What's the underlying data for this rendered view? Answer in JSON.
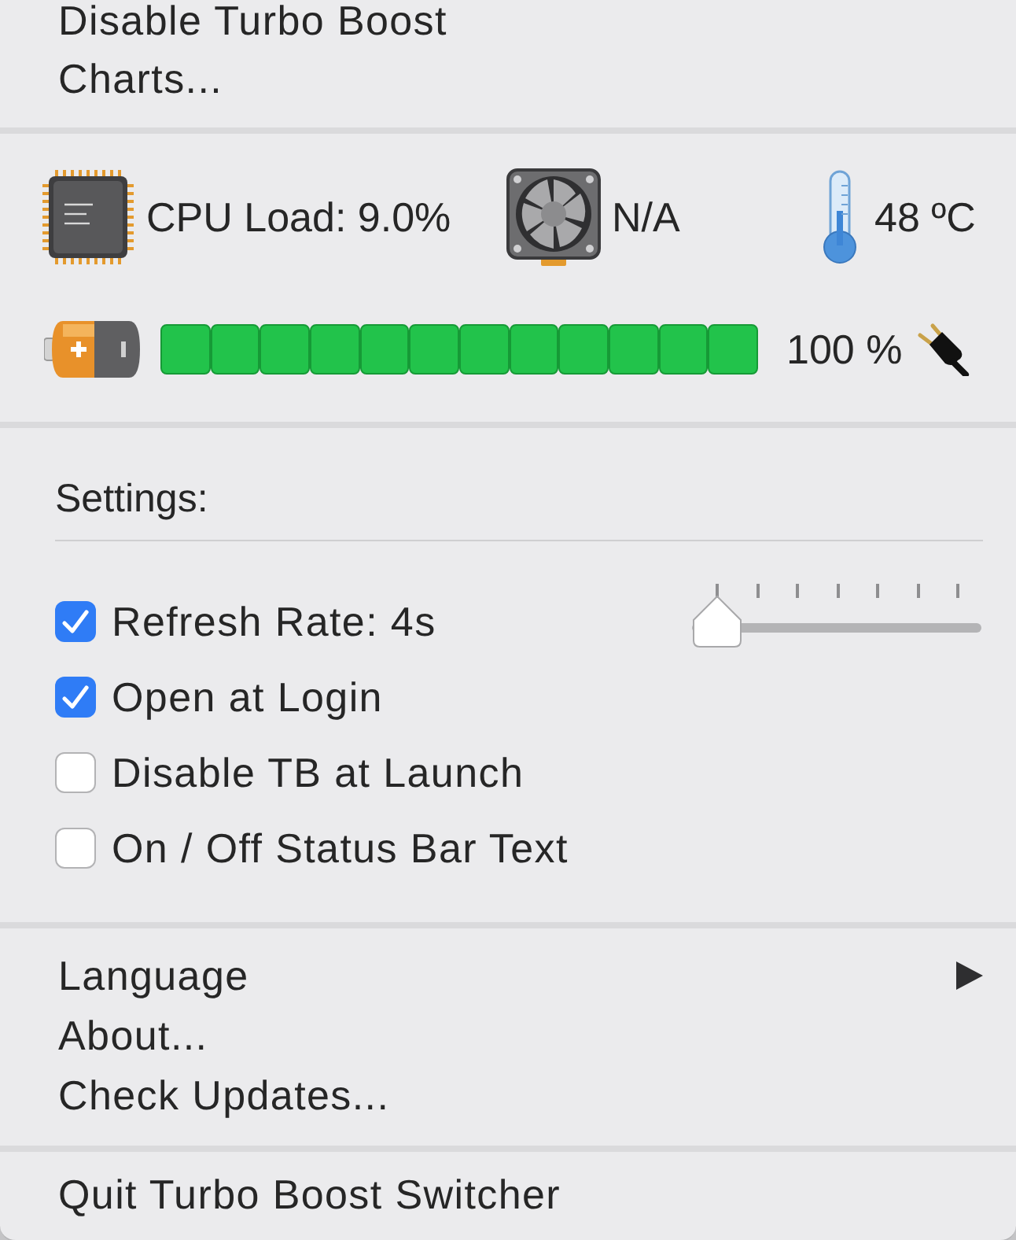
{
  "top_menu": [
    {
      "label": "Disable Turbo Boost"
    },
    {
      "label": "Charts..."
    }
  ],
  "stats": {
    "cpu_load": "CPU Load: 9.0%",
    "fan_speed": "N/A",
    "temperature": "48 ºC"
  },
  "battery": {
    "level": 1,
    "reading": "100 %",
    "plugged_in": true
  },
  "settings": {
    "title": "Settings:",
    "options": [
      {
        "kind": "slider",
        "label": "Refresh Rate: 4s",
        "checked": true,
        "level": 0
      },
      {
        "kind": "checkbox",
        "label": "Open at Login",
        "checked": true
      },
      {
        "kind": "checkbox",
        "label": "Disable TB at Launch",
        "checked": false
      },
      {
        "kind": "checkbox",
        "label": "On / Off Status Bar Text",
        "checked": false
      }
    ]
  },
  "bottom_menu": [
    {
      "label": "Language",
      "submenu": true
    },
    {
      "label": "About...",
      "submenu": false
    },
    {
      "label": "Check Updates...",
      "submenu": false
    }
  ],
  "quit": {
    "label": "Quit Turbo Boost Switcher"
  }
}
